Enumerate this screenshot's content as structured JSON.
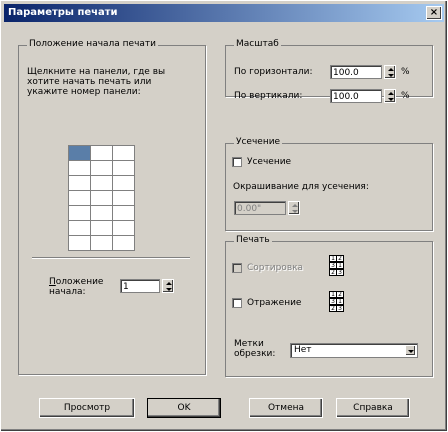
{
  "window": {
    "title": "Параметры печати",
    "close_glyph": "×"
  },
  "position_group": {
    "legend": "Положение начала печати",
    "instruction": [
      "Щелкните на панели, где вы",
      "хотите начать печать или",
      "укажите номер панели:"
    ],
    "grid": {
      "rows": 7,
      "cols": 3,
      "selected_panel": 1
    },
    "start_label_line1": "Положение",
    "start_label_line2": "начала:",
    "start_value": "1"
  },
  "scale_group": {
    "legend": "Масштаб",
    "horizontal_label": "По горизонтали:",
    "horizontal_value": "100.0",
    "vertical_label": "По вертикали:",
    "vertical_value": "100.0",
    "unit": "%"
  },
  "clip_group": {
    "legend": "Усечение",
    "clip_checkbox_label": "Усечение",
    "fill_label": "Окрашивание для усечения:",
    "fill_value": "0.00\""
  },
  "print_group": {
    "legend": "Печать",
    "sort_label": "Сортировка",
    "mirror_label": "Отражение",
    "order_icon_digits": [
      "1",
      "2",
      "3"
    ],
    "crop_label_line1": "Метки",
    "crop_label_line2": "обрезки:",
    "crop_value": "Нет"
  },
  "buttons": {
    "preview": "Просмотр",
    "ok": "OK",
    "cancel": "Отмена",
    "help": "Справка"
  }
}
